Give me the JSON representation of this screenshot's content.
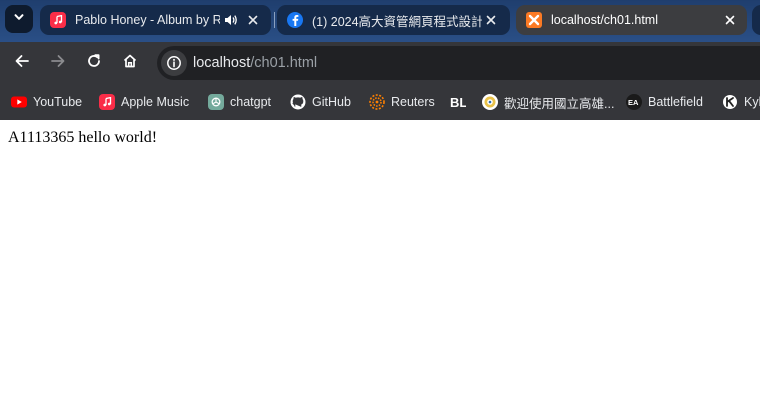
{
  "tabs": [
    {
      "title": "Pablo Honey - Album by R",
      "favicon": "apple-music-icon",
      "audio": true,
      "active": false
    },
    {
      "title": "(1) 2024高大資管網頁程式設計",
      "favicon": "facebook-icon",
      "active": false
    },
    {
      "title": "localhost/ch01.html",
      "favicon": "xampp-icon",
      "active": true
    }
  ],
  "address_bar": {
    "host": "localhost",
    "path": "/ch01.html"
  },
  "bookmarks": [
    {
      "label": "YouTube",
      "icon": "youtube-icon"
    },
    {
      "label": "Apple Music",
      "icon": "apple-music-icon"
    },
    {
      "label": "chatgpt",
      "icon": "chatgpt-icon"
    },
    {
      "label": "GitHub",
      "icon": "github-icon"
    },
    {
      "label": "Reuters",
      "icon": "reuters-icon"
    },
    {
      "label": "",
      "icon": "bl-icon"
    },
    {
      "label": "歡迎使用國立高雄...",
      "icon": "nuk-icon"
    },
    {
      "label": "Battlefield",
      "icon": "ea-icon"
    },
    {
      "label": "Kyb",
      "icon": "kyber-icon"
    }
  ],
  "page": {
    "text": "A1113365 hello world!"
  },
  "colors": {
    "tabstrip": "#2a4f86",
    "toolbar": "#35363a",
    "active_tab": "#3c3d40",
    "page_background": "#ffffff"
  }
}
